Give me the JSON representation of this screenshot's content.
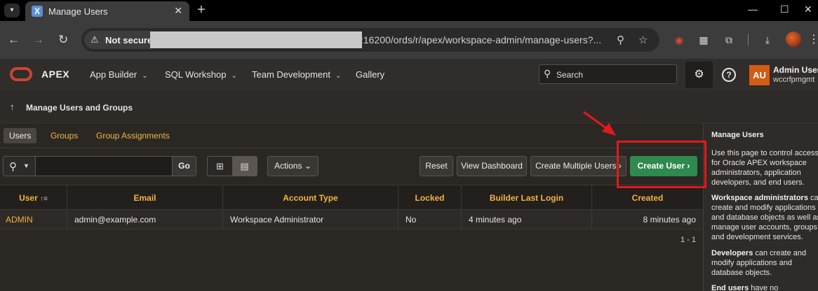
{
  "browser": {
    "tab_title": "Manage Users",
    "tab_favicon_glyph": "X",
    "not_secure": "Not secure",
    "url_visible": ":16200/ords/r/apex/workspace-admin/manage-users?..."
  },
  "apex": {
    "brand": "APEX",
    "menu": [
      {
        "label": "App Builder"
      },
      {
        "label": "SQL Workshop"
      },
      {
        "label": "Team Development"
      },
      {
        "label": "Gallery"
      }
    ],
    "search_placeholder": "Search",
    "user": {
      "initials": "AU",
      "name": "Admin User",
      "workspace": "wccrfpmgmt"
    }
  },
  "breadcrumb": {
    "label": "Manage Users and Groups"
  },
  "tabs": [
    {
      "label": "Users",
      "active": true
    },
    {
      "label": "Groups",
      "active": false
    },
    {
      "label": "Group Assignments",
      "active": false
    }
  ],
  "toolbar": {
    "go": "Go",
    "actions": "Actions",
    "reset": "Reset",
    "view_dashboard": "View Dashboard",
    "create_multiple": "Create Multiple Users",
    "create_user": "Create User"
  },
  "grid": {
    "columns": [
      "User",
      "Email",
      "Account Type",
      "Locked",
      "Builder Last Login",
      "Created"
    ],
    "rows": [
      [
        "ADMIN",
        "admin@example.com",
        "Workspace Administrator",
        "No",
        "4 minutes ago",
        "8 minutes ago"
      ]
    ],
    "pagination": "1 - 1"
  },
  "sidebar": {
    "title": "Manage Users",
    "p1": "Use this page to control access for Oracle APEX workspace administrators, application developers, and end users.",
    "p2_bold": "Workspace administrators",
    "p2_rest": " can create and modify applications and database objects as well as manage user accounts, groups, and development services.",
    "p3_bold": "Developers",
    "p3_rest": " can create and modify applications and database objects.",
    "p4_bold": "End users",
    "p4_rest": " have no"
  },
  "colors": {
    "accent_link": "#f0b541",
    "primary_button": "#2f8a4f",
    "annotation": "#e4181c",
    "brand_logo": "#c74634"
  }
}
